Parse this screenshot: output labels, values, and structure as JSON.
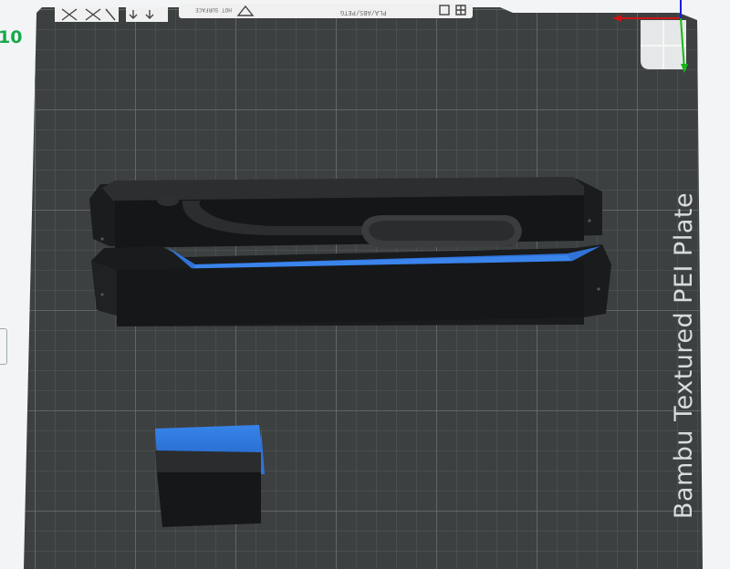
{
  "plate": {
    "name": "Bambu Textured PEI Plate",
    "hot_surface_text": "HOT SURFACE",
    "materials_text": "PLA/ABS/PETG",
    "edge_label": "10"
  },
  "objects": [
    {
      "name": "tube-holder-top-half"
    },
    {
      "name": "tube-holder-bottom-half"
    },
    {
      "name": "small-cube"
    }
  ],
  "axes": {
    "x_color": "#d01414",
    "y_color": "#14b814",
    "z_color": "#1a1ae0"
  },
  "colors": {
    "plate": "#3d4041",
    "grid": "#5a5e5f",
    "filament": "#2f73d9",
    "model": "#1c1d1e"
  }
}
